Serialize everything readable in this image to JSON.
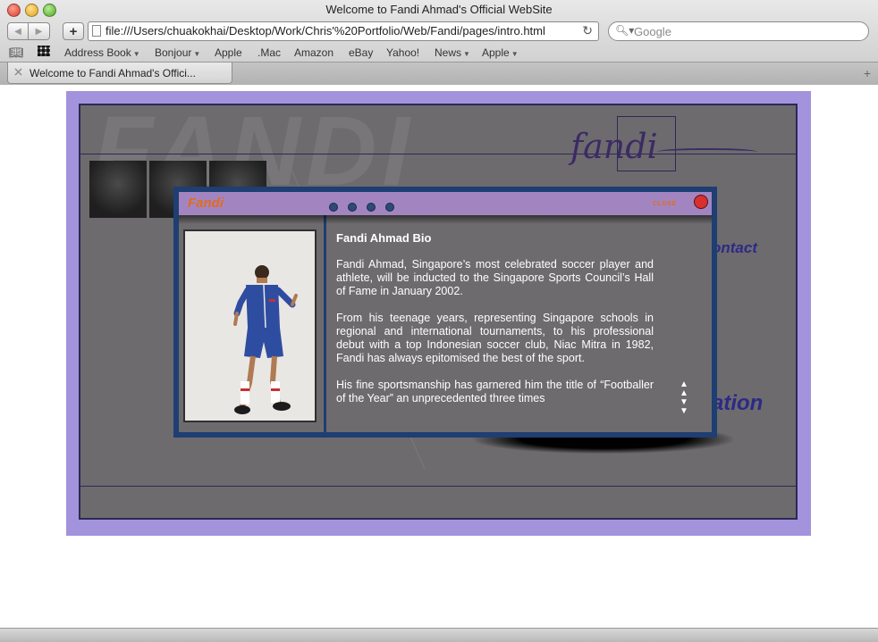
{
  "browser": {
    "window_title": "Welcome to Fandi Ahmad's Official WebSite",
    "url": "file:///Users/chuakokhai/Desktop/Work/Chris'%20Portfolio/Web/Fandi/pages/intro.html",
    "search_placeholder": "Google",
    "bookmarks": [
      {
        "label": "Address Book",
        "has_menu": true
      },
      {
        "label": "Bonjour",
        "has_menu": true
      },
      {
        "label": "Apple",
        "has_menu": false
      },
      {
        "label": ".Mac",
        "has_menu": false
      },
      {
        "label": "Amazon",
        "has_menu": false
      },
      {
        "label": "eBay",
        "has_menu": false
      },
      {
        "label": "Yahoo!",
        "has_menu": false
      },
      {
        "label": "News",
        "has_menu": true
      },
      {
        "label": "Apple",
        "has_menu": true
      }
    ],
    "tab_label": "Welcome to Fandi Ahmad's Offici...",
    "icons": {
      "back": "arrow-left-icon",
      "forward": "arrow-right-icon",
      "add_bookmark": "plus-icon",
      "reload": "reload-icon",
      "search": "magnifier-icon",
      "bookmarks_book": "book-icon",
      "bookmarks_grid": "grid-icon",
      "new_tab": "plus-icon"
    }
  },
  "site": {
    "frame_color": "#a393dd",
    "content_color": "#6d6b6e",
    "watermark": "FANDI",
    "logo_text": "fandi",
    "nav": {
      "contact": "ontact",
      "foundation": "ation"
    },
    "popup": {
      "brand": "Fandi",
      "close_label": "CLOSE",
      "page_dots": 4,
      "bio_title": "Fandi Ahmad Bio",
      "paragraphs": [
        "Fandi Ahmad, Singapore’s most celebrated soccer player and athlete, will be inducted to the Singapore Sports Council’s Hall of Fame in January 2002.",
        "From his teenage years, representing Singapore schools in regional and international tournaments, to his professional debut with a top Indonesian soccer club, Niac Mitra in 1982, Fandi has always epitomised the best of the sport.",
        "His fine sportsmanship has garnered him the title of “Footballer of the Year” an unprecedented three times"
      ],
      "accent_color": "#e26b1e",
      "border_color": "#1f3e72",
      "header_color": "#a285c0"
    }
  }
}
